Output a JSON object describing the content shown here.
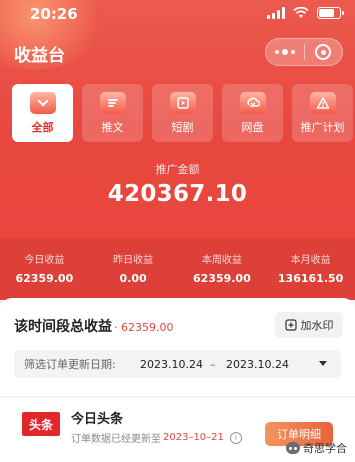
{
  "status": {
    "time": "20:26"
  },
  "header": {
    "title": "收益台"
  },
  "tabs": [
    {
      "label": "全部",
      "icon": "chevron-down-icon",
      "active": true
    },
    {
      "label": "推文",
      "icon": "article-icon",
      "active": false
    },
    {
      "label": "短剧",
      "icon": "play-icon",
      "active": false
    },
    {
      "label": "网盘",
      "icon": "cloud-sync-icon",
      "active": false
    },
    {
      "label": "推广计划",
      "icon": "warning-icon",
      "active": false
    }
  ],
  "promo": {
    "label": "推广金额",
    "amount": "420367.10"
  },
  "stats": [
    {
      "label": "今日收益",
      "value": "62359.00"
    },
    {
      "label": "昨日收益",
      "value": "0.00"
    },
    {
      "label": "本周收益",
      "value": "62359.00"
    },
    {
      "label": "本月收益",
      "value": "136161.50"
    }
  ],
  "period": {
    "title": "该时间段总收益",
    "total": "· 62359.00",
    "watermark_button": "加水印",
    "filter_label": "筛选订单更新日期:",
    "start_date": "2023.10.24",
    "dash": "–",
    "end_date": "2023.10.24"
  },
  "platform": {
    "logo_text": "头条",
    "name": "今日头条",
    "update_prefix": "订单数据已经更新至",
    "update_date": "2023–10–21",
    "detail_button": "订单明细"
  },
  "watermark": {
    "text": "奇思学合"
  },
  "colors": {
    "primary": "#e8473f",
    "accent": "#e3453b",
    "button": "#ec7a4c"
  }
}
